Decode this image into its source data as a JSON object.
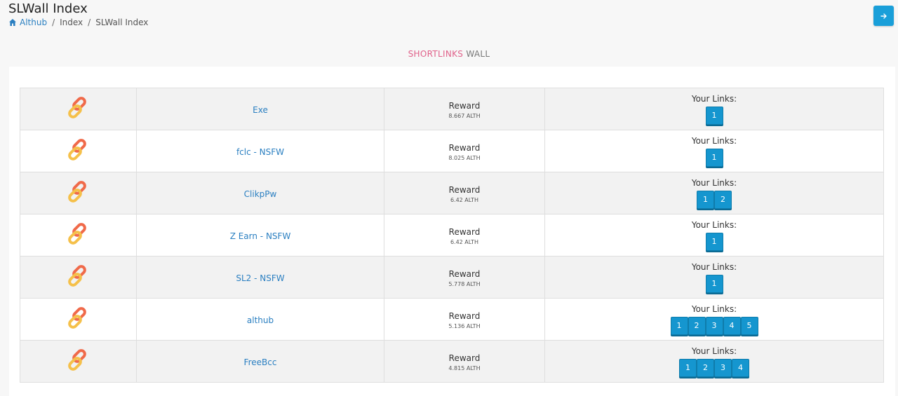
{
  "header": {
    "title": "SLWall Index",
    "breadcrumb": [
      {
        "label": "Althub"
      },
      {
        "label": "Index"
      },
      {
        "label": "SLWall Index"
      }
    ]
  },
  "section": {
    "title_accent": "SHORTLINKS",
    "title_rest": "WALL"
  },
  "colors": {
    "accent": "#1a9fd9",
    "title_accent": "#e0618a",
    "link": "#2a7fc1"
  },
  "icons": {
    "home": "home-icon",
    "corner_button": "arrow-right-icon",
    "row": "chain-link-icon"
  },
  "rows": [
    {
      "name": "Exe",
      "reward_label": "Reward",
      "reward": "8.667 ALTH",
      "links_label": "Your Links:",
      "links": [
        "1"
      ]
    },
    {
      "name": "fclc - NSFW",
      "reward_label": "Reward",
      "reward": "8.025 ALTH",
      "links_label": "Your Links:",
      "links": [
        "1"
      ]
    },
    {
      "name": "ClikpPw",
      "reward_label": "Reward",
      "reward": "6.42 ALTH",
      "links_label": "Your Links:",
      "links": [
        "1",
        "2"
      ]
    },
    {
      "name": "Z Earn - NSFW",
      "reward_label": "Reward",
      "reward": "6.42 ALTH",
      "links_label": "Your Links:",
      "links": [
        "1"
      ]
    },
    {
      "name": "SL2 - NSFW",
      "reward_label": "Reward",
      "reward": "5.778 ALTH",
      "links_label": "Your Links:",
      "links": [
        "1"
      ]
    },
    {
      "name": "althub",
      "reward_label": "Reward",
      "reward": "5.136 ALTH",
      "links_label": "Your Links:",
      "links": [
        "1",
        "2",
        "3",
        "4",
        "5"
      ]
    },
    {
      "name": "FreeBcc",
      "reward_label": "Reward",
      "reward": "4.815 ALTH",
      "links_label": "Your Links:",
      "links": [
        "1",
        "2",
        "3",
        "4"
      ]
    }
  ]
}
